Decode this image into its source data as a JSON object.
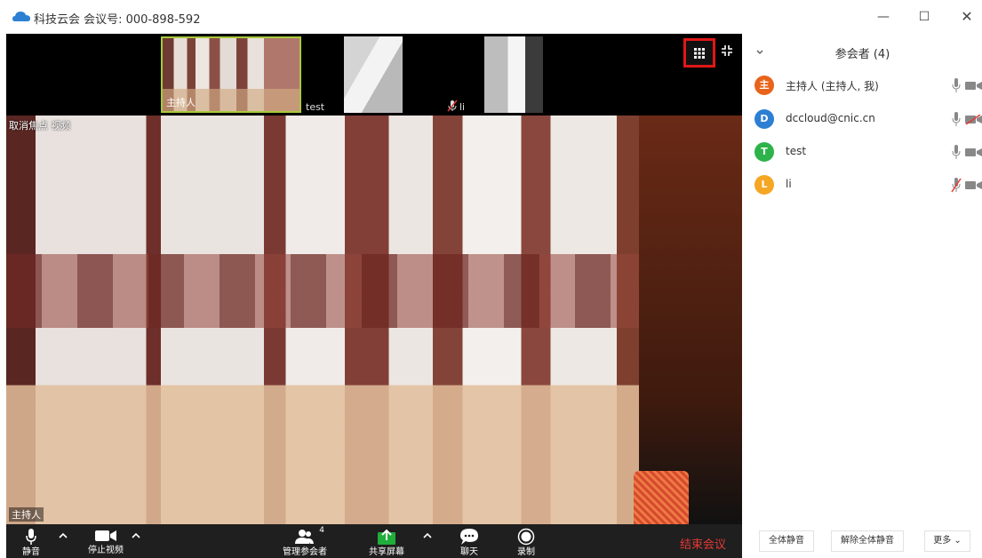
{
  "window": {
    "title": "科技云会 会议号: 000-898-592",
    "controls": {
      "minimize": "—",
      "maximize": "☐",
      "close": "✕"
    }
  },
  "video": {
    "thumbnails": [
      {
        "name": "主持人",
        "active": true
      },
      {
        "name": "test",
        "active": false
      },
      {
        "name": "li",
        "active": false,
        "mic_muted": true
      }
    ],
    "main_overlay_label": "取消焦点 视频",
    "main_speaker_label": "主持人"
  },
  "toolbar": {
    "mute_label": "静音",
    "video_label": "停止视频",
    "manage_label": "管理参会者",
    "participant_count": "4",
    "share_label": "共享屏幕",
    "chat_label": "聊天",
    "record_label": "录制",
    "end_label": "结束会议",
    "colors": {
      "end": "#e53935",
      "share": "#1fae3a"
    }
  },
  "panel": {
    "title": "参会者 (4)",
    "participants": [
      {
        "initial": "主",
        "name": "主持人 (主持人, 我)",
        "color": "#e8641b",
        "mic": "on",
        "video": "on"
      },
      {
        "initial": "D",
        "name": "dccloud@cnic.cn",
        "color": "#2d7fd3",
        "mic": "on",
        "video": "off"
      },
      {
        "initial": "T",
        "name": "test",
        "color": "#2db34a",
        "mic": "on",
        "video": "on"
      },
      {
        "initial": "L",
        "name": "li",
        "color": "#f5a623",
        "mic": "off",
        "video": "on"
      }
    ],
    "footer": {
      "mute_all": "全体静音",
      "unmute_all": "解除全体静音",
      "more": "更多 ⌄"
    }
  }
}
